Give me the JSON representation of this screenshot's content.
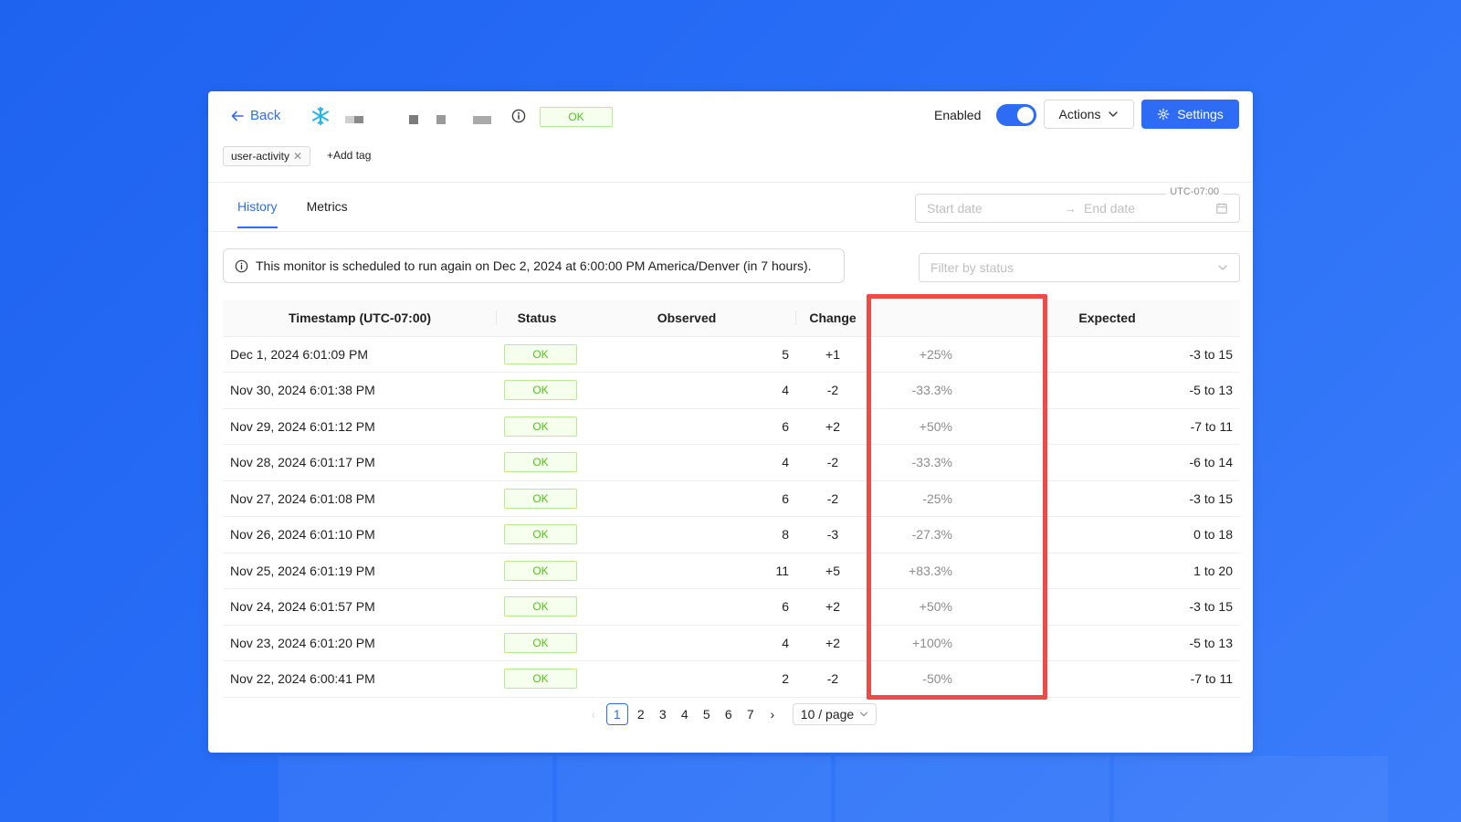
{
  "header": {
    "back_label": "Back",
    "status": "OK",
    "enabled_label": "Enabled",
    "actions_label": "Actions",
    "settings_label": "Settings",
    "tags": [
      "user-activity"
    ],
    "add_tag_label": "+Add tag"
  },
  "tabs": [
    {
      "label": "History",
      "active": true
    },
    {
      "label": "Metrics",
      "active": false
    }
  ],
  "date_range": {
    "timezone": "UTC-07:00",
    "start_placeholder": "Start date",
    "end_placeholder": "End date"
  },
  "notice": "This monitor is scheduled to run again on Dec 2, 2024 at 6:00:00 PM America/Denver (in 7 hours).",
  "filter_placeholder": "Filter by status",
  "table": {
    "headers": {
      "timestamp": "Timestamp (UTC-07:00)",
      "status": "Status",
      "observed": "Observed",
      "change": "Change",
      "expected": "Expected"
    },
    "rows": [
      {
        "timestamp": "Dec 1, 2024 6:01:09 PM",
        "status": "OK",
        "observed": "5",
        "change": "+1",
        "pct": "+25%",
        "expected": "-3 to 15"
      },
      {
        "timestamp": "Nov 30, 2024 6:01:38 PM",
        "status": "OK",
        "observed": "4",
        "change": "-2",
        "pct": "-33.3%",
        "expected": "-5 to 13"
      },
      {
        "timestamp": "Nov 29, 2024 6:01:12 PM",
        "status": "OK",
        "observed": "6",
        "change": "+2",
        "pct": "+50%",
        "expected": "-7 to 11"
      },
      {
        "timestamp": "Nov 28, 2024 6:01:17 PM",
        "status": "OK",
        "observed": "4",
        "change": "-2",
        "pct": "-33.3%",
        "expected": "-6 to 14"
      },
      {
        "timestamp": "Nov 27, 2024 6:01:08 PM",
        "status": "OK",
        "observed": "6",
        "change": "-2",
        "pct": "-25%",
        "expected": "-3 to 15"
      },
      {
        "timestamp": "Nov 26, 2024 6:01:10 PM",
        "status": "OK",
        "observed": "8",
        "change": "-3",
        "pct": "-27.3%",
        "expected": "0 to 18"
      },
      {
        "timestamp": "Nov 25, 2024 6:01:19 PM",
        "status": "OK",
        "observed": "11",
        "change": "+5",
        "pct": "+83.3%",
        "expected": "1 to 20"
      },
      {
        "timestamp": "Nov 24, 2024 6:01:57 PM",
        "status": "OK",
        "observed": "6",
        "change": "+2",
        "pct": "+50%",
        "expected": "-3 to 15"
      },
      {
        "timestamp": "Nov 23, 2024 6:01:20 PM",
        "status": "OK",
        "observed": "4",
        "change": "+2",
        "pct": "+100%",
        "expected": "-5 to 13"
      },
      {
        "timestamp": "Nov 22, 2024 6:00:41 PM",
        "status": "OK",
        "observed": "2",
        "change": "-2",
        "pct": "-50%",
        "expected": "-7 to 11"
      }
    ]
  },
  "pagination": {
    "pages": [
      "1",
      "2",
      "3",
      "4",
      "5",
      "6",
      "7"
    ],
    "current": "1",
    "page_size": "10 / page"
  },
  "colors": {
    "accent": "#2f6cf6",
    "ok_green": "#52c41a",
    "highlight_red": "#ef4a45"
  },
  "icons": [
    "arrow-left-icon",
    "snowflake-icon",
    "info-icon",
    "chevron-down-icon",
    "gear-icon",
    "close-icon",
    "plus-icon",
    "calendar-icon",
    "chevron-left-icon",
    "chevron-right-icon"
  ]
}
